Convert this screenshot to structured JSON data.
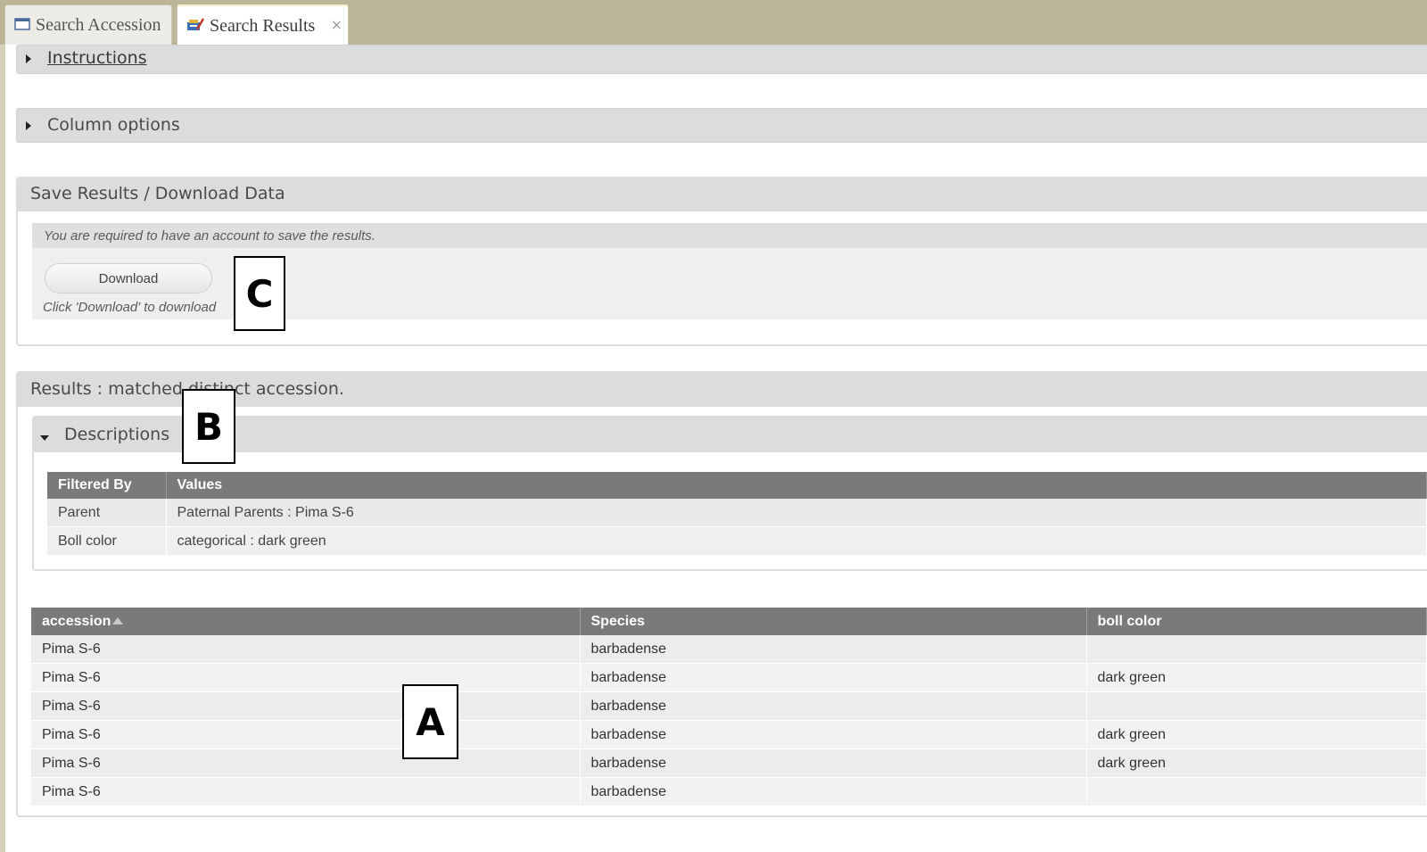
{
  "tabs": [
    {
      "label": "Search Accession",
      "icon": "window-icon"
    },
    {
      "label": "Search Results",
      "icon": "results-icon",
      "close": "×"
    }
  ],
  "instructions": {
    "label": "Instructions"
  },
  "column_options": {
    "label": "Column options"
  },
  "save_panel": {
    "title": "Save Results / Download Data",
    "account_note": "You are required to have an account to save the results.",
    "download_button": "Download",
    "download_hint": "Click 'Download' to download"
  },
  "results_panel": {
    "title": "Results : matched distinct accession."
  },
  "descriptions": {
    "label": "Descriptions",
    "headers": [
      "Filtered By",
      "Values"
    ],
    "rows": [
      [
        "Parent",
        "Paternal Parents : Pima S-6"
      ],
      [
        "Boll color",
        "categorical : dark green"
      ]
    ]
  },
  "results_table": {
    "headers": [
      "accession",
      "Species",
      "boll color"
    ],
    "rows": [
      [
        "Pima S-6",
        "barbadense",
        ""
      ],
      [
        "Pima S-6",
        "barbadense",
        "dark green"
      ],
      [
        "Pima S-6",
        "barbadense",
        ""
      ],
      [
        "Pima S-6",
        "barbadense",
        "dark green"
      ],
      [
        "Pima S-6",
        "barbadense",
        "dark green"
      ],
      [
        "Pima S-6",
        "barbadense",
        ""
      ]
    ]
  },
  "annotations": {
    "a": "A",
    "b": "B",
    "c": "C"
  },
  "colors": {
    "tab_strip": "#bbb699",
    "bar_grey": "#dcdcdc",
    "table_header": "#7a7a7a"
  }
}
